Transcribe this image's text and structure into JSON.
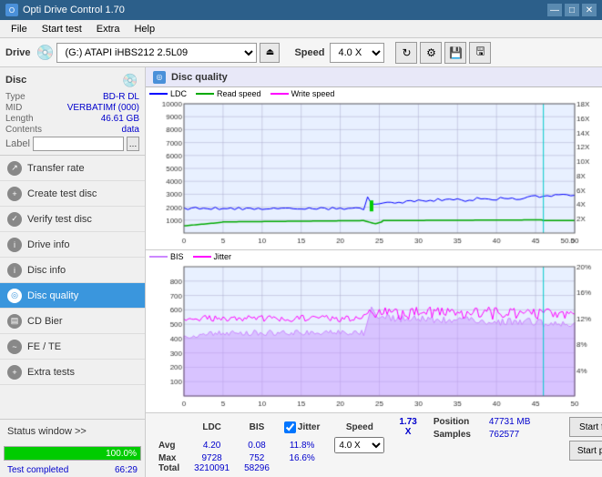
{
  "app": {
    "title": "Opti Drive Control 1.70",
    "icon": "O"
  },
  "title_buttons": {
    "minimize": "—",
    "maximize": "□",
    "close": "✕"
  },
  "menu": {
    "items": [
      "File",
      "Start test",
      "Extra",
      "Help"
    ]
  },
  "drive_bar": {
    "label": "Drive",
    "drive_value": "(G:)  ATAPI iHBS212  2.5L09",
    "speed_label": "Speed",
    "speed_value": "4.0 X"
  },
  "disc": {
    "title": "Disc",
    "type_label": "Type",
    "type_value": "BD-R DL",
    "mid_label": "MID",
    "mid_value": "VERBATIMf (000)",
    "length_label": "Length",
    "length_value": "46.61 GB",
    "contents_label": "Contents",
    "contents_value": "data",
    "label_label": "Label",
    "label_value": ""
  },
  "nav": {
    "items": [
      {
        "id": "transfer-rate",
        "label": "Transfer rate",
        "active": false
      },
      {
        "id": "create-test-disc",
        "label": "Create test disc",
        "active": false
      },
      {
        "id": "verify-test-disc",
        "label": "Verify test disc",
        "active": false
      },
      {
        "id": "drive-info",
        "label": "Drive info",
        "active": false
      },
      {
        "id": "disc-info",
        "label": "Disc info",
        "active": false
      },
      {
        "id": "disc-quality",
        "label": "Disc quality",
        "active": true
      },
      {
        "id": "cd-bier",
        "label": "CD Bier",
        "active": false
      },
      {
        "id": "fe-te",
        "label": "FE / TE",
        "active": false
      },
      {
        "id": "extra-tests",
        "label": "Extra tests",
        "active": false
      }
    ]
  },
  "status_window": {
    "label": "Status window >>",
    "progress": 100,
    "progress_text": "100.0%",
    "status_text": "Test completed",
    "time_text": "66:29"
  },
  "quality_panel": {
    "title": "Disc quality",
    "legend1": {
      "ldc_label": "LDC",
      "read_label": "Read speed",
      "write_label": "Write speed"
    },
    "legend2": {
      "bis_label": "BIS",
      "jitter_label": "Jitter"
    },
    "chart1": {
      "y_max": 10000,
      "y_right_max": 18,
      "x_max": 50,
      "grid_lines_y": [
        1000,
        2000,
        3000,
        4000,
        5000,
        6000,
        7000,
        8000,
        9000,
        10000
      ],
      "grid_lines_x": [
        0,
        5,
        10,
        15,
        20,
        25,
        30,
        35,
        40,
        45,
        50
      ],
      "right_labels": [
        2,
        4,
        6,
        8,
        10,
        12,
        14,
        16,
        18
      ]
    },
    "chart2": {
      "y_max": 900,
      "y_right_max": 20,
      "x_max": 50,
      "grid_lines_y": [
        100,
        200,
        300,
        400,
        500,
        600,
        700,
        800
      ],
      "right_labels": [
        4,
        8,
        12,
        16,
        20
      ]
    },
    "stats": {
      "headers": [
        "",
        "LDC",
        "BIS",
        "",
        "Jitter",
        "Speed",
        ""
      ],
      "avg_label": "Avg",
      "avg_ldc": "4.20",
      "avg_bis": "0.08",
      "avg_jitter": "11.8%",
      "max_label": "Max",
      "max_ldc": "9728",
      "max_bis": "752",
      "max_jitter": "16.6%",
      "total_label": "Total",
      "total_ldc": "3210091",
      "total_bis": "58296",
      "speed_display": "1.73 X",
      "speed_select": "4.0 X",
      "position_label": "Position",
      "position_value": "47731 MB",
      "samples_label": "Samples",
      "samples_value": "762577"
    },
    "buttons": {
      "start_full": "Start full",
      "start_part": "Start part"
    }
  },
  "colors": {
    "ldc": "#0000ff",
    "read_speed": "#00aa00",
    "write_speed": "#ff00ff",
    "bis": "#dd88ff",
    "jitter": "#ff00ff",
    "grid": "#ccccff",
    "bg_chart": "#ffffff",
    "progress_green": "#00cc00",
    "active_nav_bg": "#3a96dd"
  }
}
